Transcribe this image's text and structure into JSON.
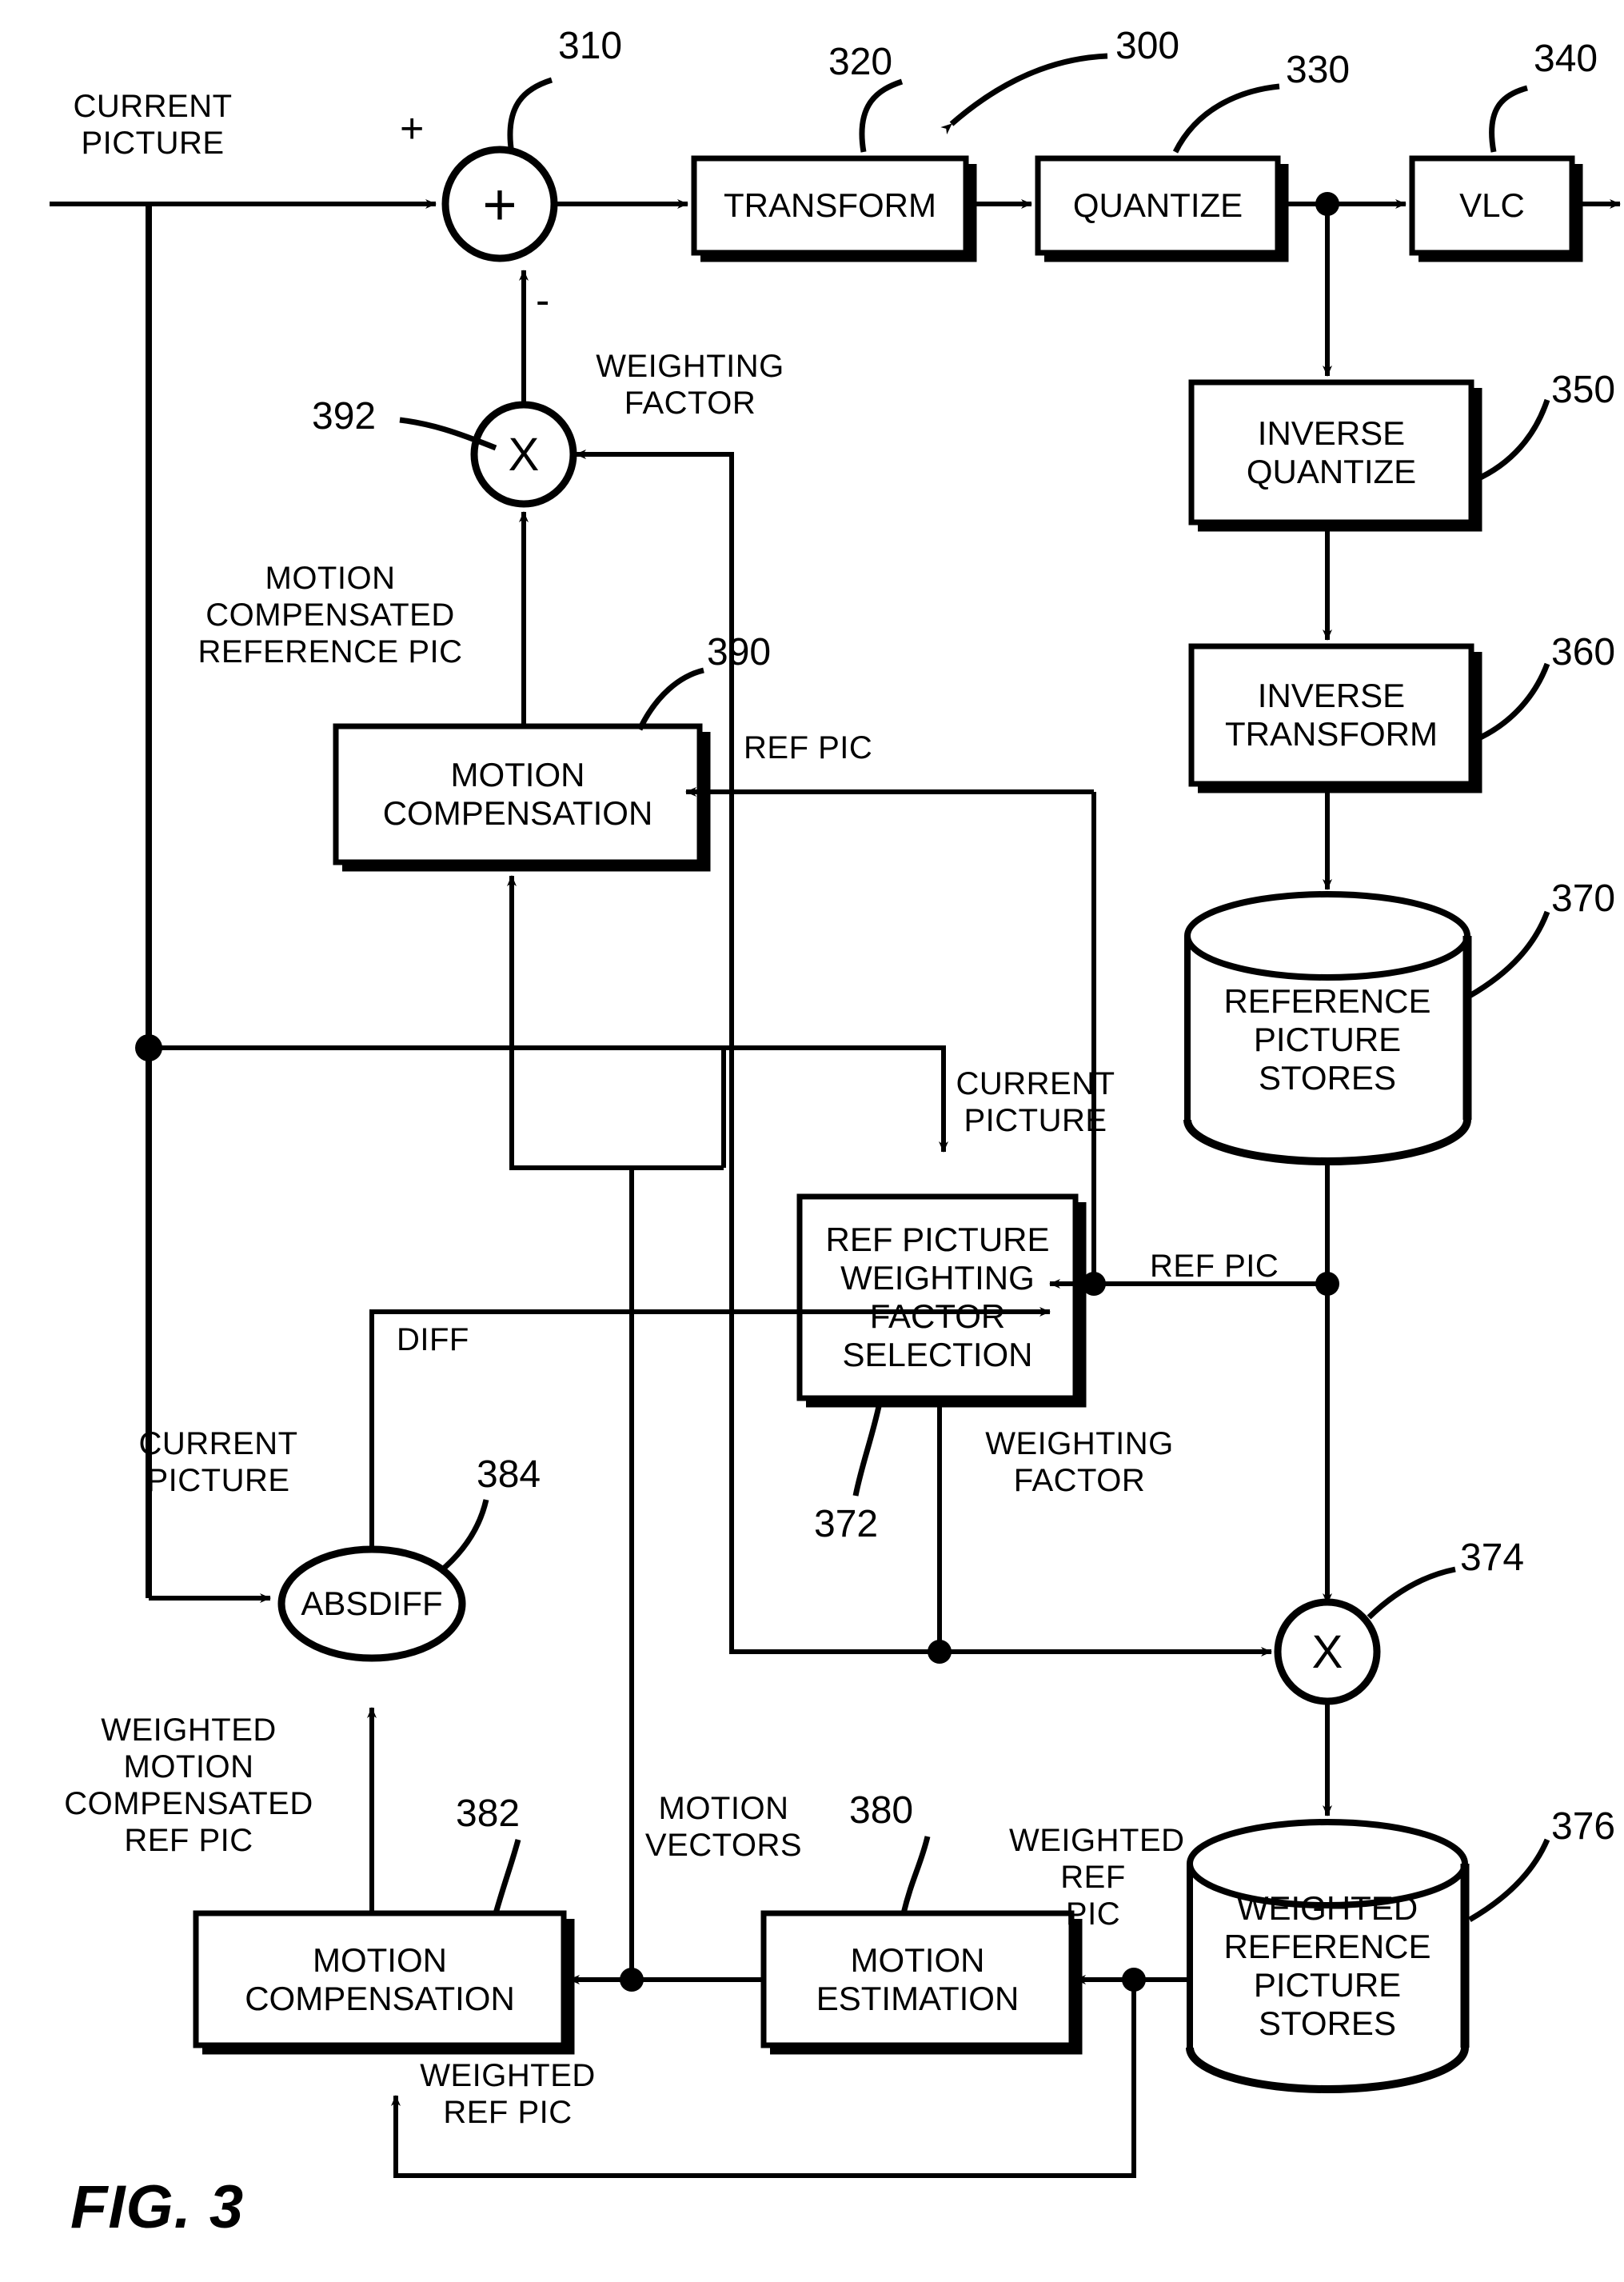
{
  "figure": {
    "caption": "FIG. 3",
    "system_ref": "300"
  },
  "blocks": [
    {
      "id": "transform",
      "label": "TRANSFORM",
      "ref": "320"
    },
    {
      "id": "quantize",
      "label": "QUANTIZE",
      "ref": "330"
    },
    {
      "id": "vlc",
      "label": "VLC",
      "ref": "340"
    },
    {
      "id": "inverse-quantize",
      "label": "INVERSE\nQUANTIZE",
      "ref": "350"
    },
    {
      "id": "inverse-transform",
      "label": "INVERSE\nTRANSFORM",
      "ref": "360"
    },
    {
      "id": "ref-pic-stores",
      "label": "REFERENCE\nPICTURE\nSTORES",
      "ref": "370"
    },
    {
      "id": "weighting-select",
      "label": "REF PICTURE\nWEIGHTING\nFACTOR\nSELECTION",
      "ref": "372"
    },
    {
      "id": "weighted-stores",
      "label": "WEIGHTED\nREFERENCE\nPICTURE\nSTORES",
      "ref": "376"
    },
    {
      "id": "motion-estimation",
      "label": "MOTION\nESTIMATION",
      "ref": "380"
    },
    {
      "id": "motion-comp-382",
      "label": "MOTION\nCOMPENSATION",
      "ref": "382"
    },
    {
      "id": "motion-comp-390",
      "label": "MOTION\nCOMPENSATION",
      "ref": "390"
    }
  ],
  "operators": [
    {
      "id": "summer",
      "symbol": "+",
      "ref": "310",
      "plus_sign": "+",
      "minus_sign": "-"
    },
    {
      "id": "mult-392",
      "symbol": "X",
      "ref": "392"
    },
    {
      "id": "absdiff",
      "symbol": "ABSDIFF",
      "ref": "384"
    },
    {
      "id": "mult-374",
      "symbol": "X",
      "ref": "374"
    }
  ],
  "signals": {
    "current_picture_in": "CURRENT\nPICTURE",
    "weighting_factor_top": "WEIGHTING\nFACTOR",
    "motion_comp_ref_pic": "MOTION\nCOMPENSATED\nREFERENCE PIC",
    "ref_pic_mid": "REF PIC",
    "current_picture_mid": "CURRENT\nPICTURE",
    "ref_pic_right": "REF PIC",
    "diff": "DIFF",
    "current_picture_left": "CURRENT\nPICTURE",
    "weighting_factor_mid": "WEIGHTING\nFACTOR",
    "weighted_motion_comp_ref_pic": "WEIGHTED\nMOTION\nCOMPENSATED\nREF PIC",
    "motion_vectors": "MOTION\nVECTORS",
    "weighted_ref_pic_right": "WEIGHTED\nREF\nPIC",
    "weighted_ref_pic_bottom": "WEIGHTED\nREF PIC"
  },
  "refs": {
    "r300": "300",
    "r310": "310",
    "r320": "320",
    "r330": "330",
    "r340": "340",
    "r350": "350",
    "r360": "360",
    "r370": "370",
    "r372": "372",
    "r374": "374",
    "r376": "376",
    "r380": "380",
    "r382": "382",
    "r384": "384",
    "r390": "390",
    "r392": "392"
  },
  "colors": {
    "ink": "#000000",
    "paper": "#ffffff"
  }
}
